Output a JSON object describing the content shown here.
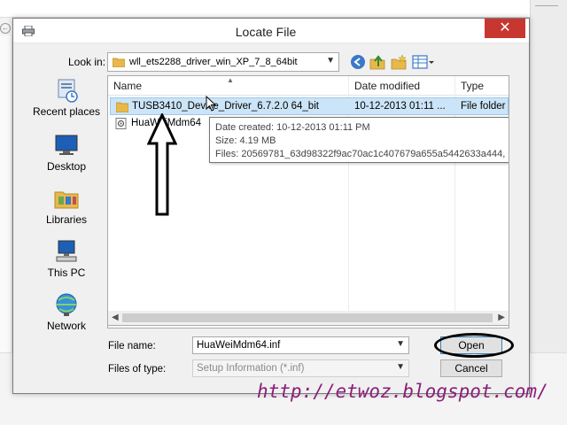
{
  "dialog": {
    "title": "Locate File",
    "close_glyph": "✕",
    "look_in_label": "Look in:",
    "look_in_value": "wll_ets2288_driver_win_XP_7_8_64bit"
  },
  "places": [
    {
      "label": "Recent places",
      "icon": "recent-places-icon"
    },
    {
      "label": "Desktop",
      "icon": "desktop-icon"
    },
    {
      "label": "Libraries",
      "icon": "libraries-icon"
    },
    {
      "label": "This PC",
      "icon": "this-pc-icon"
    },
    {
      "label": "Network",
      "icon": "network-icon"
    }
  ],
  "columns": {
    "name": "Name",
    "date": "Date modified",
    "type": "Type"
  },
  "files": [
    {
      "name": "TUSB3410_Device_Driver_6.7.2.0 64_bit",
      "date": "10-12-2013 01:11 ...",
      "type": "File folder",
      "selected": true,
      "icon": "folder-icon"
    },
    {
      "name": "HuaWeiMdm64",
      "date": "",
      "type": "",
      "selected": false,
      "icon": "setup-info-file-icon"
    }
  ],
  "tooltip": {
    "created": "Date created: 10-12-2013 01:11 PM",
    "size": "Size: 4.19 MB",
    "files": "Files: 20569781_63d98322f9ac70ac1c407679a655a5442633a444, ..."
  },
  "bottom": {
    "file_name_label": "File name:",
    "file_name_value": "HuaWeiMdm64.inf",
    "file_type_label": "Files of type:",
    "file_type_value": "Setup Information (*.inf)",
    "open_label": "Open",
    "cancel_label": "Cancel"
  },
  "annotation": {
    "url": "http://etwoz.blogspot.com/",
    "color": "#8a1f7a"
  },
  "colors": {
    "selection": "#cce4f7",
    "close_button": "#c7372f",
    "folder": "#e8b84a"
  }
}
